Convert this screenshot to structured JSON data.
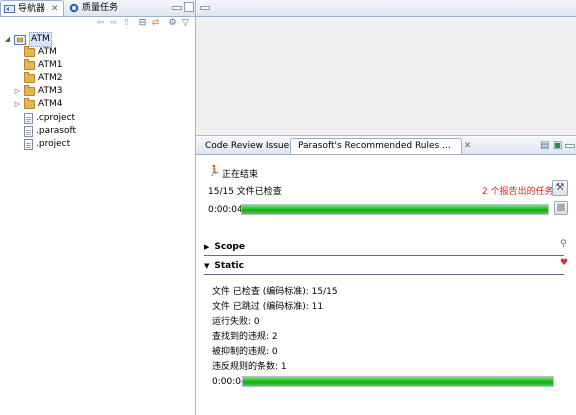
{
  "left_panel": {
    "tabs": [
      {
        "label": "导航器",
        "icon": "navigator-icon",
        "active": true
      },
      {
        "label": "质量任务",
        "icon": "parasoft-icon",
        "active": false
      }
    ],
    "tree": [
      {
        "label": "ATM",
        "type": "project",
        "expanded": true,
        "level": 0
      },
      {
        "label": "ATM",
        "type": "folder",
        "level": 1
      },
      {
        "label": "ATM1",
        "type": "folder",
        "level": 1
      },
      {
        "label": "ATM2",
        "type": "folder",
        "level": 1
      },
      {
        "label": "ATM3",
        "type": "folder",
        "collapsed": true,
        "level": 1
      },
      {
        "label": "ATM4",
        "type": "folder",
        "collapsed": true,
        "level": 1
      },
      {
        "label": ".cproject",
        "type": "file",
        "level": 1
      },
      {
        "label": ".parasoft",
        "type": "file",
        "level": 1
      },
      {
        "label": ".project",
        "type": "file",
        "level": 1
      }
    ]
  },
  "right_panel": {
    "tabs": [
      {
        "label": "Code Review Issue",
        "icon": "code-review-icon",
        "active": false
      },
      {
        "label": "Parasoft's Recommended Rules ...",
        "icon": "parasoft-icon",
        "active": true
      }
    ],
    "status_label": "正在结束",
    "files_checked": "15/15 文件已检查",
    "reported_tasks": "2 个报告出的任务",
    "elapsed_top": "0:00:04",
    "progress_top": 1.0,
    "sections": [
      {
        "label": "Scope",
        "expanded": false
      },
      {
        "label": "Static",
        "expanded": true
      }
    ],
    "stats": [
      "文件 已检查 (编码标准): 15/15",
      "文件 已跳过 (编码标准): 11",
      "运行失败: 0",
      "查找到的违规: 2",
      "被抑制的违规: 0",
      "违反规则的条数: 1"
    ],
    "elapsed_bottom": "0:00:04",
    "progress_bottom": 1.0,
    "colors": {
      "reported_tasks": "#e02020",
      "progress": "#1fbf1f"
    }
  }
}
